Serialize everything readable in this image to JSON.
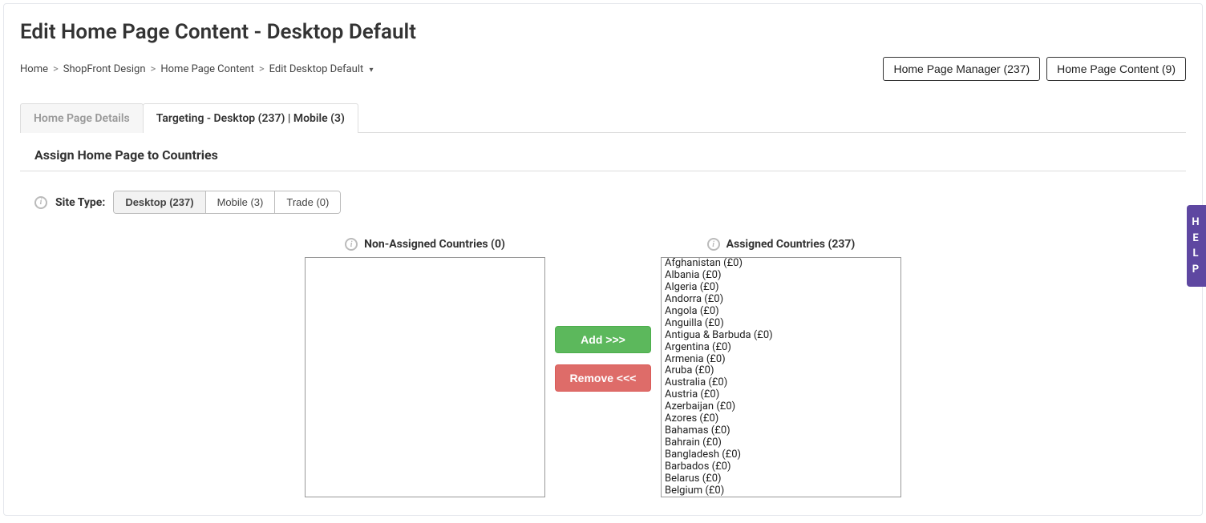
{
  "page_title": "Edit Home Page Content - Desktop Default",
  "breadcrumb": {
    "items": [
      {
        "label": "Home"
      },
      {
        "label": "ShopFront Design"
      },
      {
        "label": "Home Page Content"
      },
      {
        "label": "Edit Desktop Default",
        "has_dropdown": true
      }
    ],
    "separator": ">"
  },
  "header_buttons": {
    "manager": "Home Page Manager (237)",
    "content": "Home Page Content (9)"
  },
  "tabs": {
    "details": "Home Page Details",
    "targeting": "Targeting - Desktop (237) | Mobile (3)"
  },
  "section_title": "Assign Home Page to Countries",
  "site_type": {
    "label": "Site Type:",
    "options": {
      "desktop": "Desktop (237)",
      "mobile": "Mobile (3)",
      "trade": "Trade (0)"
    }
  },
  "lists": {
    "non_assigned_label": "Non-Assigned Countries (0)",
    "assigned_label": "Assigned Countries (237)",
    "non_assigned": [],
    "assigned": [
      "Afghanistan (£0)",
      "Albania (£0)",
      "Algeria (£0)",
      "Andorra (£0)",
      "Angola (£0)",
      "Anguilla (£0)",
      "Antigua & Barbuda (£0)",
      "Argentina (£0)",
      "Armenia (£0)",
      "Aruba (£0)",
      "Australia (£0)",
      "Austria (£0)",
      "Azerbaijan (£0)",
      "Azores (£0)",
      "Bahamas (£0)",
      "Bahrain (£0)",
      "Bangladesh (£0)",
      "Barbados (£0)",
      "Belarus (£0)",
      "Belgium (£0)"
    ]
  },
  "buttons": {
    "add": "Add >>>",
    "remove": "Remove <<<"
  },
  "help": {
    "c1": "H",
    "c2": "E",
    "c3": "L",
    "c4": "P"
  }
}
